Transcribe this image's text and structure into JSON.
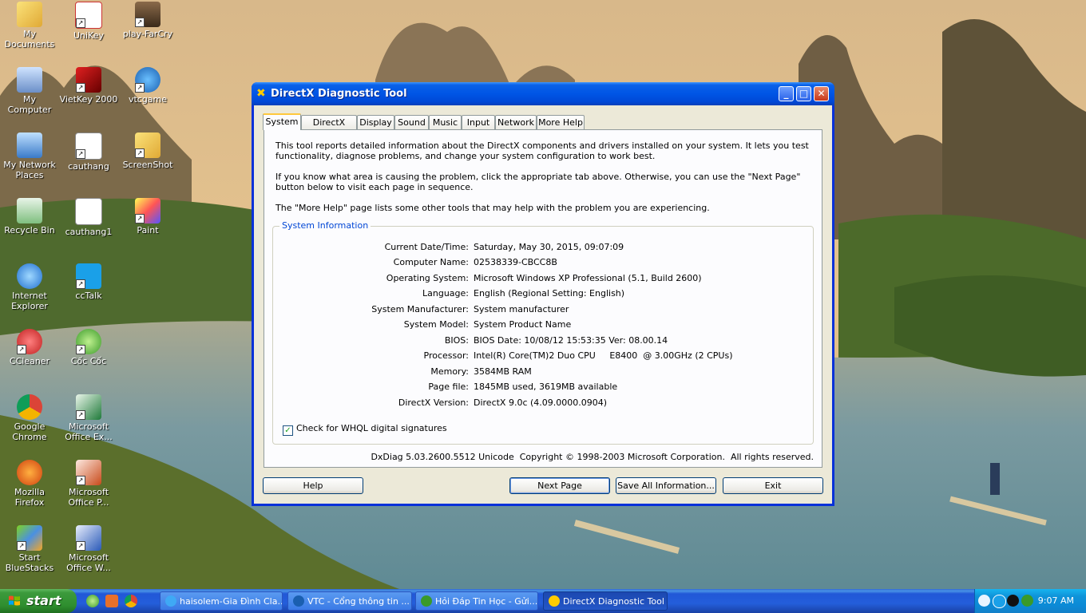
{
  "desktop": {
    "icons": [
      {
        "label": "My Documents"
      },
      {
        "label": "UniKey"
      },
      {
        "label": "play-FarCry"
      },
      {
        "label": "My Computer"
      },
      {
        "label": "VietKey 2000"
      },
      {
        "label": "vtcgame"
      },
      {
        "label": "My Network Places"
      },
      {
        "label": "cauthang"
      },
      {
        "label": "ScreenShot"
      },
      {
        "label": "Recycle Bin"
      },
      {
        "label": "cauthang1"
      },
      {
        "label": "Paint"
      },
      {
        "label": "Internet Explorer"
      },
      {
        "label": "ccTalk"
      },
      {
        "label": "CCleaner"
      },
      {
        "label": "Cốc Cốc"
      },
      {
        "label": "Google Chrome"
      },
      {
        "label": "Microsoft Office Ex..."
      },
      {
        "label": "Mozilla Firefox"
      },
      {
        "label": "Microsoft Office P..."
      },
      {
        "label": "Start BlueStacks"
      },
      {
        "label": "Microsoft Office W..."
      }
    ]
  },
  "window": {
    "title": "DirectX Diagnostic Tool",
    "minimize_glyph": "_",
    "maximize_glyph": "□",
    "close_glyph": "✕",
    "tabs": [
      {
        "label": "System"
      },
      {
        "label": "DirectX Files"
      },
      {
        "label": "Display"
      },
      {
        "label": "Sound"
      },
      {
        "label": "Music"
      },
      {
        "label": "Input"
      },
      {
        "label": "Network"
      },
      {
        "label": "More Help"
      }
    ],
    "intro_1": "This tool reports detailed information about the DirectX components and drivers installed on your system.  It lets you test functionality, diagnose problems, and change your system configuration to work best.",
    "intro_2": "If you know what area is causing the problem, click the appropriate tab above.  Otherwise, you can use the \"Next Page\" button below to visit each page in sequence.",
    "intro_3": "The \"More Help\" page lists some other tools that may help with the problem you are experiencing.",
    "group_title": "System Information",
    "info": [
      {
        "label": "Current Date/Time:",
        "value": "Saturday, May 30, 2015, 09:07:09"
      },
      {
        "label": "Computer Name:",
        "value": "02538339-CBCC8B"
      },
      {
        "label": "Operating System:",
        "value": "Microsoft Windows XP Professional (5.1, Build 2600)"
      },
      {
        "label": "Language:",
        "value": "English (Regional Setting: English)"
      },
      {
        "label": "System Manufacturer:",
        "value": "System manufacturer"
      },
      {
        "label": "System Model:",
        "value": "System Product Name"
      },
      {
        "label": "BIOS:",
        "value": "BIOS Date: 10/08/12 15:53:35 Ver: 08.00.14"
      },
      {
        "label": "Processor:",
        "value": "Intel(R) Core(TM)2 Duo CPU     E8400  @ 3.00GHz (2 CPUs)"
      },
      {
        "label": "Memory:",
        "value": "3584MB RAM"
      },
      {
        "label": "Page file:",
        "value": "1845MB used, 3619MB available"
      },
      {
        "label": "DirectX Version:",
        "value": "DirectX 9.0c (4.09.0000.0904)"
      }
    ],
    "whql_label": "Check for WHQL digital signatures",
    "whql_checked": true,
    "copyright": "DxDiag 5.03.2600.5512 Unicode  Copyright © 1998-2003 Microsoft Corporation.  All rights reserved.",
    "buttons": {
      "help": "Help",
      "next": "Next Page",
      "save": "Save All Information...",
      "exit": "Exit"
    }
  },
  "taskbar": {
    "start_label": "start",
    "tasks": [
      {
        "label": "haisolem-Gia Đình Cla..."
      },
      {
        "label": "VTC - Cổng thông tin ..."
      },
      {
        "label": "Hỏi Đáp Tin Học - Gửi..."
      },
      {
        "label": "DirectX Diagnostic Tool"
      }
    ],
    "clock": "9:07 AM"
  },
  "colors": {
    "xp_blue": "#0055e5",
    "tab_highlight": "#ffc83c",
    "group_label": "#0046d5",
    "start_green": "#3c9a3c"
  }
}
